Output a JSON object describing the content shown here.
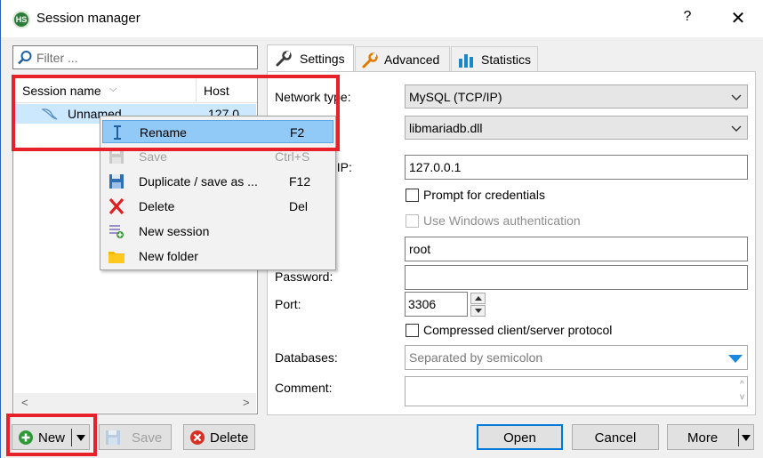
{
  "window": {
    "title": "Session manager",
    "help_label": "?",
    "close_label": "✕",
    "app_icon_text": "HS"
  },
  "filter": {
    "placeholder": "Filter ..."
  },
  "tree": {
    "columns": [
      "Session name",
      "Host"
    ],
    "sort_glyph": "⌵",
    "rows": [
      {
        "name": "Unnamed",
        "host": "127.0"
      }
    ],
    "scroll_left": "<",
    "scroll_right": ">"
  },
  "context_menu": {
    "items": [
      {
        "label": "Rename",
        "shortcut": "F2",
        "icon": "rename-icon",
        "selected": true,
        "enabled": true
      },
      {
        "label": "Save",
        "shortcut": "Ctrl+S",
        "icon": "save-icon",
        "selected": false,
        "enabled": false
      },
      {
        "label": "Duplicate / save as ...",
        "shortcut": "F12",
        "icon": "duplicate-icon",
        "selected": false,
        "enabled": true
      },
      {
        "label": "Delete",
        "shortcut": "Del",
        "icon": "delete-icon",
        "selected": false,
        "enabled": true
      },
      {
        "label": "New session",
        "shortcut": "",
        "icon": "new-session-icon",
        "selected": false,
        "enabled": true
      },
      {
        "label": "New folder",
        "shortcut": "",
        "icon": "folder-icon",
        "selected": false,
        "enabled": true
      }
    ]
  },
  "tabs": [
    {
      "label": "Settings",
      "icon": "wrench-icon",
      "active": true
    },
    {
      "label": "Advanced",
      "icon": "wrench-orange-icon",
      "active": false
    },
    {
      "label": "Statistics",
      "icon": "bar-chart-icon",
      "active": false
    }
  ],
  "settings": {
    "network_type_label": "Network type:",
    "network_type_value": "MySQL (TCP/IP)",
    "library_value": "libmariadb.dll",
    "host_label": "/ IP:",
    "host_value": "127.0.0.1",
    "prompt_credentials_label": "Prompt for credentials",
    "prompt_credentials_checked": false,
    "windows_auth_label": "Use Windows authentication",
    "windows_auth_checked": false,
    "windows_auth_enabled": false,
    "user_value": "root",
    "password_label": "Password:",
    "password_value": "",
    "port_label": "Port:",
    "port_value": "3306",
    "compressed_label": "Compressed client/server protocol",
    "compressed_checked": false,
    "databases_label": "Databases:",
    "databases_placeholder": "Separated by semicolon",
    "comment_label": "Comment:",
    "comment_value": "",
    "comment_scroll_up": "^",
    "comment_scroll_down": "v"
  },
  "buttons": {
    "new": "New",
    "save": "Save",
    "delete": "Delete",
    "open": "Open",
    "cancel": "Cancel",
    "more": "More"
  },
  "colors": {
    "highlight_box": "#e8202a",
    "selection": "#cce8ff",
    "menu_selection": "#91c9f7",
    "accent": "#0078d7"
  }
}
